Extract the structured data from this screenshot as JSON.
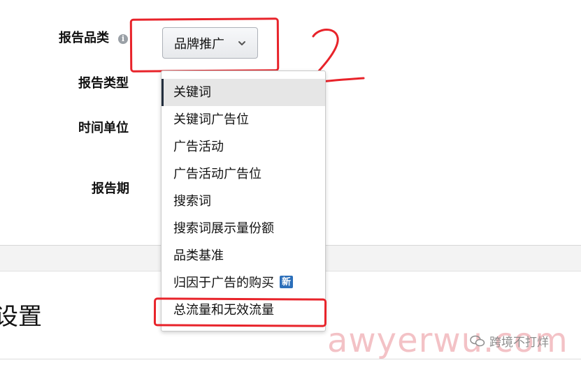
{
  "form": {
    "category_label": "报告品类",
    "type_label": "报告类型",
    "time_unit_label": "时间单位",
    "period_label": "报告期",
    "info_icon_glyph": "i",
    "category_button_value": "品牌推广"
  },
  "dropdown": {
    "items": [
      {
        "label": "关键词",
        "selected": true
      },
      {
        "label": "关键词广告位"
      },
      {
        "label": "广告活动"
      },
      {
        "label": "广告活动广告位"
      },
      {
        "label": "搜索词"
      },
      {
        "label": "搜索词展示量份额"
      },
      {
        "label": "品类基准"
      },
      {
        "label": "归因于广告的购买",
        "badge": "新"
      },
      {
        "label": "总流量和无效流量"
      }
    ]
  },
  "section": {
    "title_fragment": "设置"
  },
  "annotation": {
    "number": "2",
    "color": "#e8232a"
  },
  "watermark": {
    "text": "awyerwu.com",
    "account": "跨境不打烊"
  },
  "colors": {
    "highlight_red": "#e8232a",
    "selected_bar": "#232f3e",
    "badge_blue": "#2c6fba"
  }
}
